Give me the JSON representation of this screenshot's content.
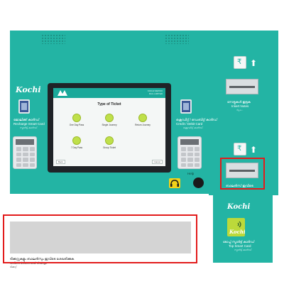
{
  "left_panel": {
    "logo": "Kochi",
    "label_ml": "ജോലിക്ക് കാർഡ്",
    "label_en": "Recharge Smart Card",
    "label_sub": "സ്മാർട്ട് കാർഡ്"
  },
  "center_panel": {
    "label_ml": "ക്രെഡിറ്റ് / ഡെബിറ്റ് കാർഡ്",
    "label_en": "Credit / Debit Card",
    "label_sub": "ക്രെഡിറ്റ് കാർഡ്"
  },
  "screen": {
    "org_line1": "KOCHI METRO",
    "org_line2": "RAIL LIMITED",
    "title": "Type of Ticket",
    "options": [
      {
        "label": "One Day Pass"
      },
      {
        "label": "Single Journey"
      },
      {
        "label": "Return Journey"
      },
      {
        "label": "7 Day Pass"
      },
      {
        "label": "Group Ticket"
      }
    ],
    "back_label": "Back",
    "cancel_label": "Cancel"
  },
  "helpline": {
    "label": "Help"
  },
  "right_column": {
    "insert_notes_ml": "നോട്ടുകൾ ഇടുക",
    "insert_notes_en": "Insert Notes",
    "insert_notes_sub": "நோட்",
    "collect_ml": "ബാലൻസ് ഇവിടെ",
    "top_card_logo": "Kochi",
    "top_card_ml": "ടോപ്പ് സ്മാർട്ട് കാർഡ്",
    "top_card_en": "Top Smart Card",
    "top_card_sub": "സ്മാർട്ട് കാർഡ്"
  },
  "bottom": {
    "ml": "ടിക്കറ്റുകളും ബാലൻസും ഇവിടെ ശേഖരിക്കുക",
    "en": "Collect tickets and change",
    "sub": "ടിക്കറ്റ്"
  },
  "colors": {
    "kiosk_teal": "#23b4a4",
    "highlight_red": "#e21b1b",
    "help_yellow": "#f2d21b"
  }
}
